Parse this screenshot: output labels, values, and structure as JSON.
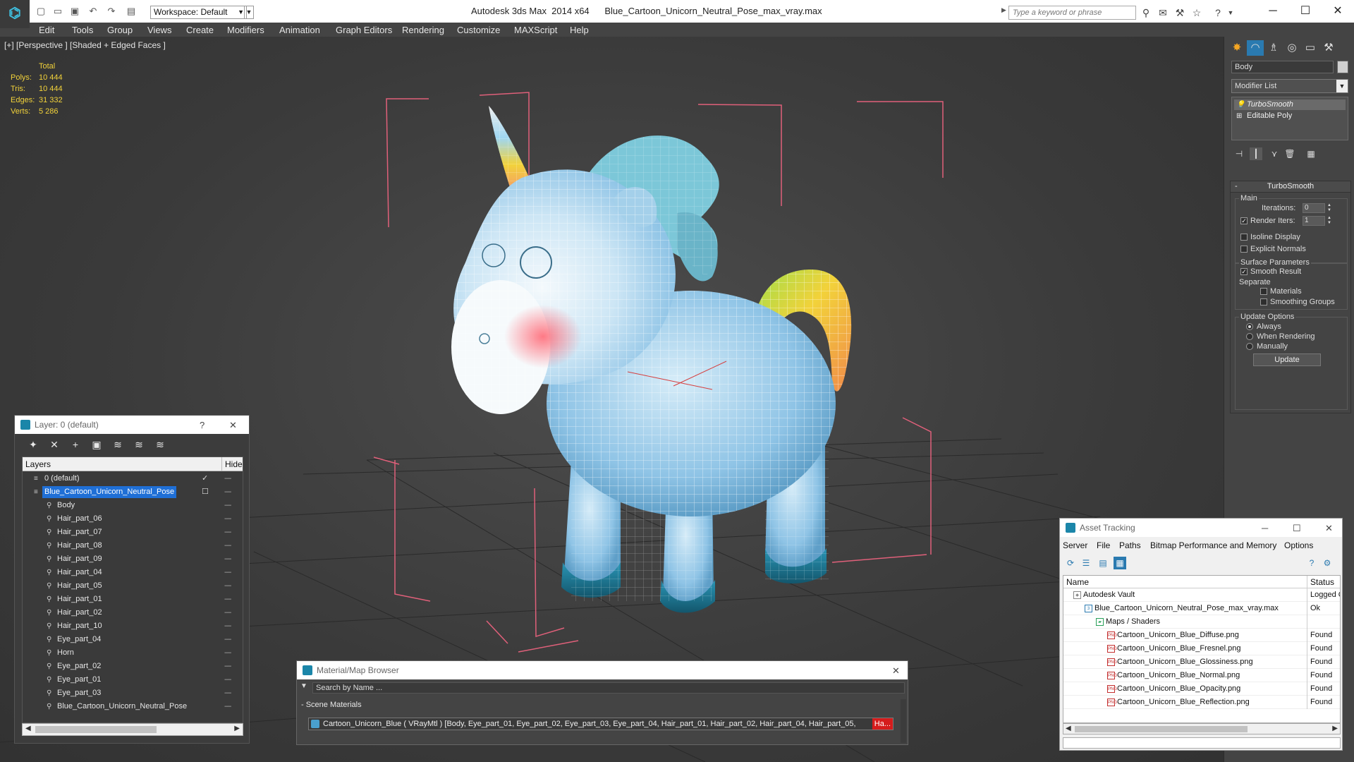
{
  "app": {
    "title": "Autodesk 3ds Max  2014 x64",
    "file": "Blue_Cartoon_Unicorn_Neutral_Pose_max_vray.max",
    "workspace": "Workspace: Default",
    "search_placeholder": "Type a keyword or phrase"
  },
  "menu": [
    "Edit",
    "Tools",
    "Group",
    "Views",
    "Create",
    "Modifiers",
    "Animation",
    "Graph Editors",
    "Rendering",
    "Customize",
    "MAXScript",
    "Help"
  ],
  "viewport": {
    "label": "[+] [Perspective ] [Shaded + Edged Faces ]",
    "stats": {
      "total_label": "Total",
      "rows": [
        {
          "label": "Polys:",
          "value": "10 444"
        },
        {
          "label": "Tris:",
          "value": "10 444"
        },
        {
          "label": "Edges:",
          "value": "31 332"
        },
        {
          "label": "Verts:",
          "value": "5 286"
        }
      ]
    }
  },
  "command_panel": {
    "object_name": "Body",
    "modifier_list": "Modifier List",
    "stack": [
      "TurboSmooth",
      "Editable Poly"
    ],
    "rollout": {
      "title": "TurboSmooth",
      "main_label": "Main",
      "iterations_label": "Iterations:",
      "iterations_value": "0",
      "render_iters_label": "Render Iters:",
      "render_iters_value": "1",
      "isoline": "Isoline Display",
      "explicit_normals": "Explicit Normals",
      "surface_params": "Surface Parameters",
      "smooth_result": "Smooth Result",
      "separate": "Separate",
      "materials": "Materials",
      "smoothing_groups": "Smoothing Groups",
      "update_options": "Update Options",
      "always": "Always",
      "when_rendering": "When Rendering",
      "manually": "Manually",
      "update_btn": "Update"
    }
  },
  "layer_window": {
    "title": "Layer: 0 (default)",
    "help": "?",
    "col_layers": "Layers",
    "col_hide": "Hide",
    "rows": [
      {
        "name": "0 (default)",
        "indent": 0,
        "type": "layer"
      },
      {
        "name": "Blue_Cartoon_Unicorn_Neutral_Pose",
        "indent": 0,
        "type": "layer",
        "selected": true
      },
      {
        "name": "Body",
        "indent": 1,
        "type": "obj"
      },
      {
        "name": "Hair_part_06",
        "indent": 1,
        "type": "obj"
      },
      {
        "name": "Hair_part_07",
        "indent": 1,
        "type": "obj"
      },
      {
        "name": "Hair_part_08",
        "indent": 1,
        "type": "obj"
      },
      {
        "name": "Hair_part_09",
        "indent": 1,
        "type": "obj"
      },
      {
        "name": "Hair_part_04",
        "indent": 1,
        "type": "obj"
      },
      {
        "name": "Hair_part_05",
        "indent": 1,
        "type": "obj"
      },
      {
        "name": "Hair_part_01",
        "indent": 1,
        "type": "obj"
      },
      {
        "name": "Hair_part_02",
        "indent": 1,
        "type": "obj"
      },
      {
        "name": "Hair_part_10",
        "indent": 1,
        "type": "obj"
      },
      {
        "name": "Eye_part_04",
        "indent": 1,
        "type": "obj"
      },
      {
        "name": "Horn",
        "indent": 1,
        "type": "obj"
      },
      {
        "name": "Eye_part_02",
        "indent": 1,
        "type": "obj"
      },
      {
        "name": "Eye_part_01",
        "indent": 1,
        "type": "obj"
      },
      {
        "name": "Eye_part_03",
        "indent": 1,
        "type": "obj"
      },
      {
        "name": "Blue_Cartoon_Unicorn_Neutral_Pose",
        "indent": 1,
        "type": "obj"
      }
    ]
  },
  "material_browser": {
    "title": "Material/Map Browser",
    "search_placeholder": "Search by Name ...",
    "section": "- Scene Materials",
    "material_row": "Cartoon_Unicorn_Blue  ( VRayMtl )  [Body, Eye_part_01, Eye_part_02, Eye_part_03, Eye_part_04, Hair_part_01, Hair_part_02, Hair_part_04, Hair_part_05,",
    "material_row_cut": "Ha..."
  },
  "asset_tracking": {
    "title": "Asset Tracking",
    "menu": [
      "Server",
      "File",
      "Paths",
      "Bitmap Performance and Memory",
      "Options"
    ],
    "col_name": "Name",
    "col_status": "Status",
    "rows": [
      {
        "name": "Autodesk Vault",
        "status": "Logged Out",
        "indent": 1,
        "icon": "vault"
      },
      {
        "name": "Blue_Cartoon_Unicorn_Neutral_Pose_max_vray.max",
        "status": "Ok",
        "indent": 2,
        "icon": "max"
      },
      {
        "name": "Maps / Shaders",
        "status": "",
        "indent": 3,
        "icon": "maps"
      },
      {
        "name": "Cartoon_Unicorn_Blue_Diffuse.png",
        "status": "Found",
        "indent": 4,
        "icon": "png"
      },
      {
        "name": "Cartoon_Unicorn_Blue_Fresnel.png",
        "status": "Found",
        "indent": 4,
        "icon": "png"
      },
      {
        "name": "Cartoon_Unicorn_Blue_Glossiness.png",
        "status": "Found",
        "indent": 4,
        "icon": "png"
      },
      {
        "name": "Cartoon_Unicorn_Blue_Normal.png",
        "status": "Found",
        "indent": 4,
        "icon": "png"
      },
      {
        "name": "Cartoon_Unicorn_Blue_Opacity.png",
        "status": "Found",
        "indent": 4,
        "icon": "png"
      },
      {
        "name": "Cartoon_Unicorn_Blue_Reflection.png",
        "status": "Found",
        "indent": 4,
        "icon": "png"
      }
    ]
  },
  "colors": {
    "stats": "#f2d23a",
    "selection": "#1f6fd6",
    "bbox": "#e0607a",
    "body": "#8fc4e6",
    "hooves": "#1b6f8a"
  }
}
